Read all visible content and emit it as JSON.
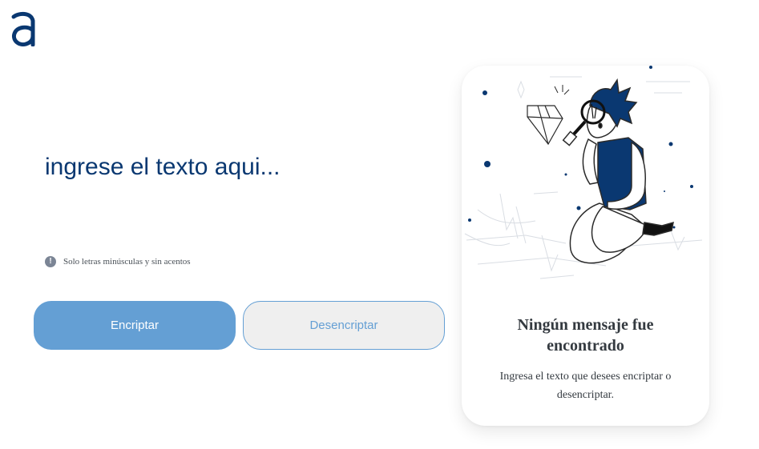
{
  "brand": {
    "logo_icon": "alura-a-logo",
    "color": "#0a3871"
  },
  "input": {
    "placeholder": "ingrese el texto aqui...",
    "value": ""
  },
  "hint": {
    "icon": "exclamation-circle-icon",
    "text": "Solo letras minúsculas y sin acentos"
  },
  "buttons": {
    "encrypt_label": "Encriptar",
    "decrypt_label": "Desencriptar",
    "accent": "#649fd4"
  },
  "output": {
    "illustration": "person-with-magnifying-glass-and-diamond",
    "title": "Ningún mensaje fue encontrado",
    "description": "Ingresa el texto que desees encriptar o desencriptar."
  }
}
